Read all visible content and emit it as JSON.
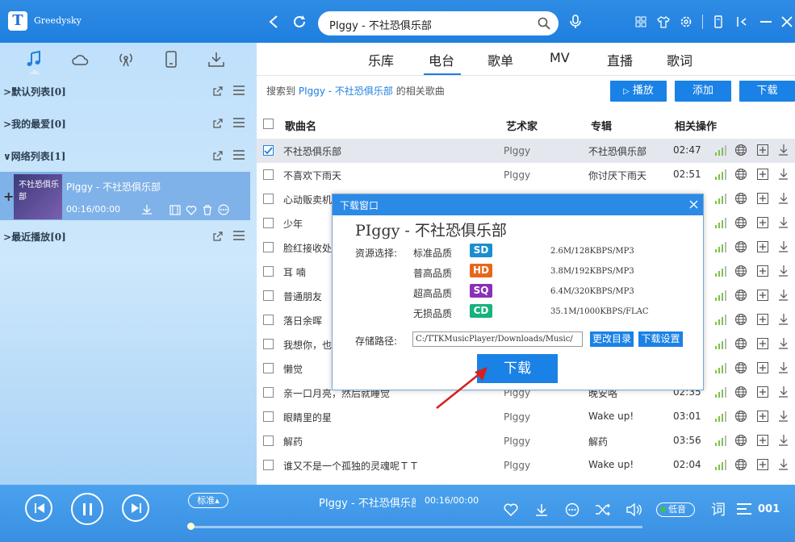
{
  "app": {
    "title": "Greedysky",
    "logo": "T"
  },
  "search": {
    "query": "PIggy - 不社恐俱乐部"
  },
  "sidebar": {
    "lists": [
      {
        "label": "默认列表[0]"
      },
      {
        "label": "我的最爱[0]"
      },
      {
        "label": "网络列表[1]"
      },
      {
        "label": "最近播放[0]"
      }
    ],
    "now_playing": {
      "cover_text": "不社恐俱乐部",
      "title": "PIggy - 不社恐俱乐部",
      "time": "00:16/00:00"
    }
  },
  "tabs": [
    "乐库",
    "电台",
    "歌单",
    "MV",
    "直播",
    "歌词"
  ],
  "active_tab": "电台",
  "result": {
    "prefix": "搜索到",
    "query": "PIggy - 不社恐俱乐部",
    "suffix": "的相关歌曲"
  },
  "actions": {
    "play": "播放",
    "add": "添加",
    "download": "下载"
  },
  "table": {
    "headers": {
      "name": "歌曲名",
      "artist": "艺术家",
      "album": "专辑",
      "ops": "相关操作"
    },
    "rows": [
      {
        "name": "不社恐俱乐部",
        "artist": "PIggy",
        "album": "不社恐俱乐部",
        "duration": "02:47",
        "checked": true
      },
      {
        "name": "不喜欢下雨天",
        "artist": "PIggy",
        "album": "你讨厌下雨天",
        "duration": "02:51",
        "checked": false
      },
      {
        "name": "心动贩卖机",
        "artist": "",
        "album": "",
        "duration": "",
        "checked": false
      },
      {
        "name": "少年",
        "artist": "",
        "album": "",
        "duration": "",
        "checked": false
      },
      {
        "name": "脸红接收处",
        "artist": "",
        "album": "",
        "duration": "",
        "checked": false
      },
      {
        "name": "耳 喃",
        "artist": "",
        "album": "",
        "duration": "",
        "checked": false
      },
      {
        "name": "普通朋友",
        "artist": "",
        "album": "",
        "duration": "",
        "checked": false
      },
      {
        "name": "落日余晖",
        "artist": "",
        "album": "",
        "duration": "",
        "checked": false
      },
      {
        "name": "我想你，也",
        "artist": "",
        "album": "",
        "duration": "",
        "checked": false
      },
      {
        "name": "懒觉",
        "artist": "",
        "album": "",
        "duration": "",
        "checked": false
      },
      {
        "name": "亲一口月亮，然后就睡觉",
        "artist": "PIggy",
        "album": "晚安咯",
        "duration": "02:35",
        "checked": false
      },
      {
        "name": "眼睛里的星",
        "artist": "PIggy",
        "album": "Wake up!",
        "duration": "03:01",
        "checked": false
      },
      {
        "name": "解药",
        "artist": "PIggy",
        "album": "解药",
        "duration": "03:56",
        "checked": false
      },
      {
        "name": "谁又不是一个孤独的灵魂呢ＴＴ",
        "artist": "PIggy",
        "album": "Wake up!",
        "duration": "02:04",
        "checked": false
      }
    ]
  },
  "dialog": {
    "title": "下载窗口",
    "song": "PIggy - 不社恐俱乐部",
    "resource_label": "资源选择:",
    "qualities": [
      {
        "label": "标准品质",
        "badge": "SD",
        "color": "#1a8fd0",
        "info": "2.6M/128KBPS/MP3"
      },
      {
        "label": "普高品质",
        "badge": "HD",
        "color": "#e8661a",
        "info": "3.8M/192KBPS/MP3"
      },
      {
        "label": "超高品质",
        "badge": "SQ",
        "color": "#8a2fb8",
        "info": "6.4M/320KBPS/MP3"
      },
      {
        "label": "无损品质",
        "badge": "CD",
        "color": "#18b27c",
        "info": "35.1M/1000KBPS/FLAC"
      }
    ],
    "path_label": "存储路径:",
    "path_value": "C:/TTKMusicPlayer/Downloads/Music/",
    "change_dir": "更改目录",
    "settings": "下载设置",
    "download": "下载"
  },
  "player": {
    "quality": "标准",
    "title": "PIggy - 不社恐俱乐部",
    "time": "00:16/00:00",
    "low_quality": "低音"
  }
}
